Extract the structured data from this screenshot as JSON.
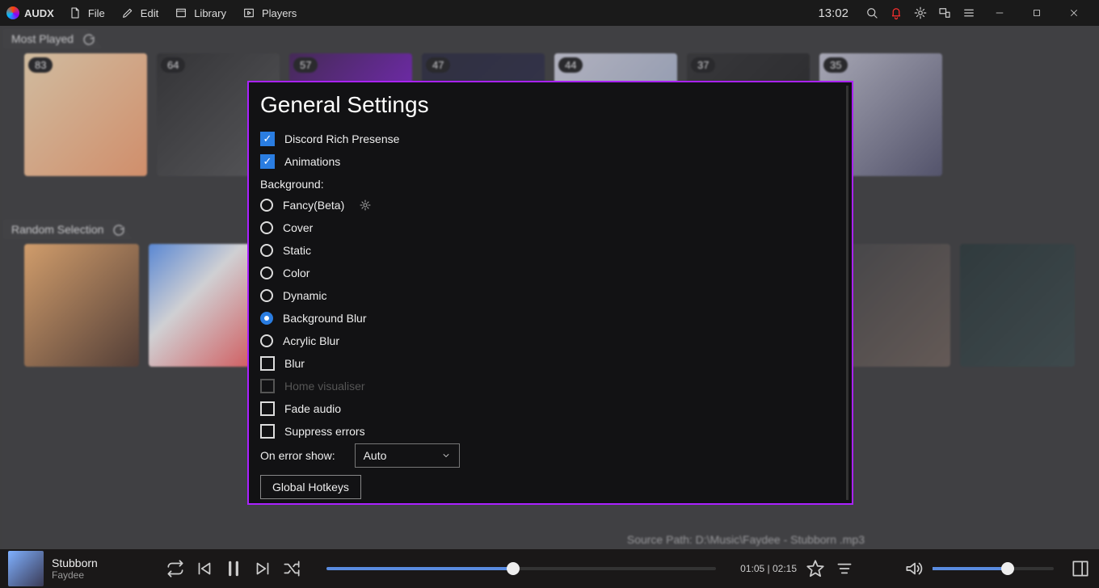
{
  "app": {
    "name": "AUDX",
    "clock": "13:02"
  },
  "menu": {
    "file": "File",
    "edit": "Edit",
    "library": "Library",
    "players": "Players"
  },
  "sections": {
    "most_played": "Most Played",
    "random_selection": "Random Selection"
  },
  "thumbs_top": [
    {
      "count": "83",
      "bg": "linear-gradient(135deg,#ffe0b0,#ff9a60)"
    },
    {
      "count": "64",
      "bg": "linear-gradient(135deg,#111,#444)"
    },
    {
      "count": "57",
      "bg": "linear-gradient(135deg,#2a0040,#8a00ff)"
    },
    {
      "count": "47",
      "bg": "linear-gradient(135deg,#0b0b20,#101030)"
    },
    {
      "count": "44",
      "bg": "linear-gradient(135deg,#d0d0e0,#8ea0c0)"
    },
    {
      "count": "37",
      "bg": "linear-gradient(135deg,#151515,#000)"
    },
    {
      "count": "35",
      "bg": "linear-gradient(135deg,#c0c0d0,#404060)"
    }
  ],
  "thumbs_random_bg": [
    "linear-gradient(135deg,#ffb060,#402010)",
    "linear-gradient(135deg,#4a90ff,#ffffff 40%,#ff4040)",
    "linear-gradient(135deg,#2a2a2a,#5a4a40)",
    "linear-gradient(135deg,#0a1a1a,#203030)"
  ],
  "modal": {
    "title": "General Settings",
    "discord": "Discord Rich Presense",
    "animations": "Animations",
    "background_label": "Background:",
    "bg_options": {
      "fancy": "Fancy(Beta)",
      "cover": "Cover",
      "static": "Static",
      "color": "Color",
      "dynamic": "Dynamic",
      "bgblur": "Background Blur",
      "acrylic": "Acrylic Blur"
    },
    "blur": "Blur",
    "home_vis": "Home visualiser",
    "fade": "Fade audio",
    "suppress": "Suppress errors",
    "on_error": "On error show:",
    "on_error_value": "Auto",
    "hotkeys": "Global Hotkeys"
  },
  "source_path": "Source Path: D:\\Music\\Faydee - Stubborn .mp3",
  "player": {
    "title": "Stubborn",
    "artist": "Faydee",
    "time": "01:05 | 02:15",
    "progress_pct": 48,
    "volume_pct": 62
  }
}
